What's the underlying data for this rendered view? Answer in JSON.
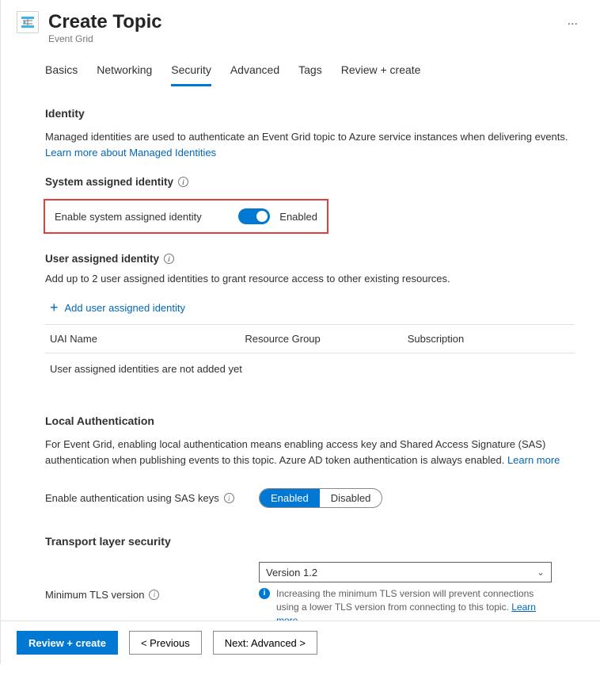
{
  "header": {
    "title": "Create Topic",
    "subtitle": "Event Grid",
    "more_label": "..."
  },
  "tabs": [
    "Basics",
    "Networking",
    "Security",
    "Advanced",
    "Tags",
    "Review + create"
  ],
  "active_tab": "Security",
  "sections": {
    "identity": {
      "title": "Identity",
      "desc_prefix": "Managed identities are used to authenticate an Event Grid topic to Azure service instances when delivering events. ",
      "link": "Learn more about Managed Identities",
      "system": {
        "title": "System assigned identity",
        "toggle_label": "Enable system assigned identity",
        "toggle_state": "Enabled"
      },
      "user": {
        "title": "User assigned identity",
        "desc": "Add up to 2 user assigned identities to grant resource access to other existing resources.",
        "add_label": "Add user assigned identity",
        "cols": [
          "UAI Name",
          "Resource Group",
          "Subscription"
        ],
        "empty": "User assigned identities are not added yet"
      }
    },
    "local_auth": {
      "title": "Local Authentication",
      "desc_prefix": "For Event Grid, enabling local authentication means enabling access key and Shared Access Signature (SAS) authentication when publishing events to this topic. Azure AD token authentication is always enabled. ",
      "link": "Learn more",
      "field_label": "Enable authentication using SAS keys",
      "options": [
        "Enabled",
        "Disabled"
      ],
      "selected": "Enabled"
    },
    "tls": {
      "title": "Transport layer security",
      "field_label": "Minimum TLS version",
      "value": "Version 1.2",
      "callout_prefix": "Increasing the minimum TLS version will prevent connections using a lower TLS version from connecting to this topic. ",
      "callout_link": "Learn more"
    }
  },
  "footer": {
    "primary": "Review + create",
    "previous": "< Previous",
    "next": "Next: Advanced >"
  }
}
